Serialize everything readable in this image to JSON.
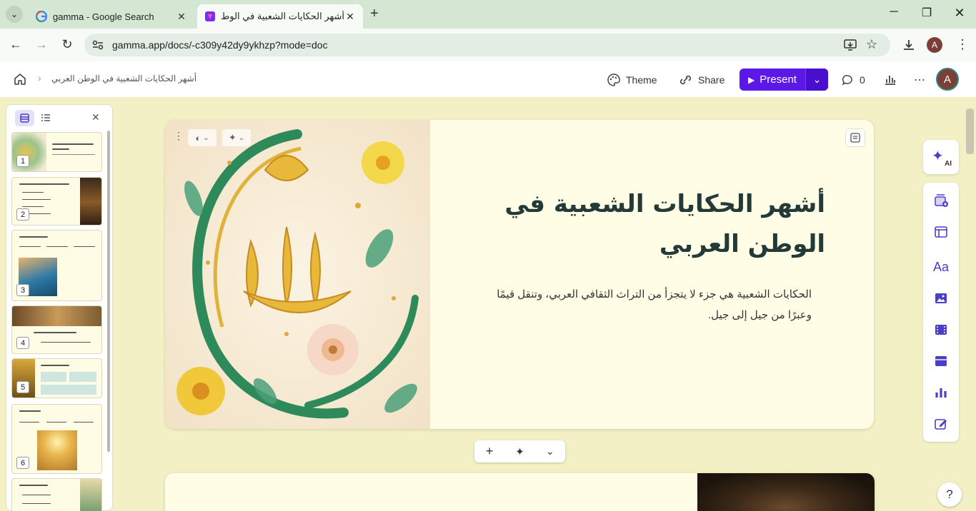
{
  "browser": {
    "tabs": [
      {
        "title": "gamma - Google Search",
        "icon": "google-icon"
      },
      {
        "title": "أشهر الحكايات الشعبية في الوطن",
        "icon": "gamma-icon"
      }
    ],
    "url": "gamma.app/docs/-c309y42dy9ykhzp?mode=doc",
    "profile_initial": "A"
  },
  "app": {
    "breadcrumb": "أشهر الحكايات الشعبية في الوطن العربي",
    "theme_label": "Theme",
    "share_label": "Share",
    "present_label": "Present",
    "comments_count": "0",
    "user_initial": "A",
    "accent": "#5b18e6"
  },
  "panel": {
    "thumbnails": [
      {
        "number": "1"
      },
      {
        "number": "2"
      },
      {
        "number": "3"
      },
      {
        "number": "4"
      },
      {
        "number": "5"
      },
      {
        "number": "6"
      }
    ]
  },
  "card": {
    "title": "أشهر الحكايات الشعبية في الوطن العربي",
    "body": "الحكايات الشعبية هي جزء لا يتجزأ من التراث الثقافي العربي، وتنقل قيمًا وعبرًا من جيل إلى جيل."
  },
  "rail": {
    "ai_label": "AI"
  },
  "help": "?"
}
